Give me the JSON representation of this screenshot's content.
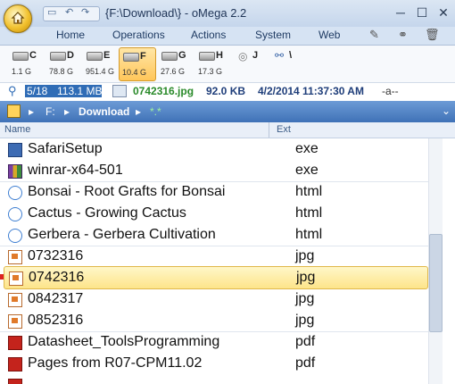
{
  "window": {
    "title": "{F:\\Download\\} - oMega 2.2",
    "quick_access": [
      "▭",
      "↶",
      "↷"
    ],
    "buttons": {
      "minimize": "─",
      "maximize": "☐",
      "close": "✕"
    }
  },
  "ribbon": {
    "tabs": [
      "Home",
      "Operations",
      "Actions",
      "System",
      "Web"
    ]
  },
  "drives": [
    {
      "letter": "C",
      "size": "1.1 G"
    },
    {
      "letter": "D",
      "size": "78.8 G"
    },
    {
      "letter": "E",
      "size": "951.4 G"
    },
    {
      "letter": "F",
      "size": "10.4 G",
      "active": true
    },
    {
      "letter": "G",
      "size": "27.6 G"
    },
    {
      "letter": "H",
      "size": "17.3 G"
    },
    {
      "letter": "J",
      "size": ""
    },
    {
      "letter": "\\",
      "size": ""
    }
  ],
  "status": {
    "count": "5/18",
    "selected_size": "113.1 MB",
    "filename": "0742316.jpg",
    "file_size": "92.0 KB",
    "datetime": "4/2/2014 11:37:30 AM",
    "attributes": "-a--"
  },
  "path": {
    "drive": "F:",
    "folder": "Download",
    "filter": "*.*"
  },
  "columns": {
    "name": "Name",
    "ext": "Ext"
  },
  "files": [
    {
      "name": "SafariSetup",
      "ext": "exe",
      "icon": "exe-icon"
    },
    {
      "name": "winrar-x64-501",
      "ext": "exe",
      "icon": "winrar-icon"
    },
    {
      "name": "Bonsai - Root Grafts for Bonsai",
      "ext": "html",
      "icon": "html-icon"
    },
    {
      "name": "Cactus - Growing Cactus",
      "ext": "html",
      "icon": "html-icon"
    },
    {
      "name": "Gerbera - Gerbera Cultivation",
      "ext": "html",
      "icon": "html-icon"
    },
    {
      "name": "0732316",
      "ext": "jpg",
      "icon": "jpg-icon"
    },
    {
      "name": "0742316",
      "ext": "jpg",
      "icon": "jpg-icon",
      "selected": true
    },
    {
      "name": "0842317",
      "ext": "jpg",
      "icon": "jpg-icon"
    },
    {
      "name": "0852316",
      "ext": "jpg",
      "icon": "jpg-icon"
    },
    {
      "name": "Datasheet_ToolsProgramming",
      "ext": "pdf",
      "icon": "pdf-icon"
    },
    {
      "name": "Pages from R07-CPM11.02",
      "ext": "pdf",
      "icon": "pdf-icon"
    }
  ]
}
